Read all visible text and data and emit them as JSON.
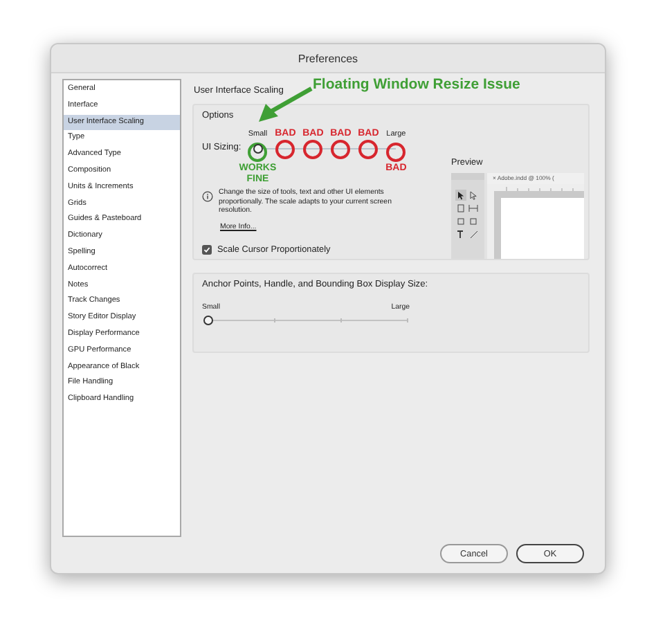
{
  "window": {
    "title": "Preferences"
  },
  "sidebar": {
    "items": [
      {
        "label": "General",
        "selected": false
      },
      {
        "label": "Interface",
        "selected": false
      },
      {
        "label": "User Interface Scaling",
        "selected": true
      },
      {
        "label": "Type",
        "selected": false
      },
      {
        "label": "Advanced Type",
        "selected": false
      },
      {
        "label": "Composition",
        "selected": false
      },
      {
        "label": "Units & Increments",
        "selected": false
      },
      {
        "label": "Grids",
        "selected": false
      },
      {
        "label": "Guides & Pasteboard",
        "selected": false
      },
      {
        "label": "Dictionary",
        "selected": false
      },
      {
        "label": "Spelling",
        "selected": false
      },
      {
        "label": "Autocorrect",
        "selected": false
      },
      {
        "label": "Notes",
        "selected": false
      },
      {
        "label": "Track Changes",
        "selected": false
      },
      {
        "label": "Story Editor Display",
        "selected": false
      },
      {
        "label": "Display Performance",
        "selected": false
      },
      {
        "label": "GPU Performance",
        "selected": false
      },
      {
        "label": "Appearance of Black",
        "selected": false
      },
      {
        "label": "File Handling",
        "selected": false
      },
      {
        "label": "Clipboard Handling",
        "selected": false
      }
    ]
  },
  "section_title": "User Interface Scaling",
  "annotation_title": "Floating Window Resize Issue",
  "options": {
    "title": "Options",
    "ui_sizing": {
      "label": "UI Sizing:",
      "level": 0,
      "stops": [
        {
          "scale_label": "Small",
          "note_below": "WORKS FINE",
          "color": "#3f9f35"
        },
        {
          "note": "BAD",
          "color": "#d7262e"
        },
        {
          "note": "BAD",
          "color": "#d7262e"
        },
        {
          "note": "BAD",
          "color": "#d7262e"
        },
        {
          "note": "BAD",
          "color": "#d7262e"
        },
        {
          "scale_label": "Large",
          "note_below": "BAD",
          "color": "#d7262e"
        }
      ]
    },
    "info": "Change the size of tools, text and other UI elements proportionally. The scale adapts to your current screen resolution.",
    "more_info_link": "More Info...",
    "scale_cursor": {
      "label": "Scale Cursor Proportionately",
      "checked": true
    },
    "preview": {
      "label": "Preview",
      "tab": "× Adobe.indd @ 100% ("
    }
  },
  "anchor_group": {
    "title": "Anchor Points, Handle, and Bounding Box Display Size:",
    "min_label": "Small",
    "max_label": "Large",
    "level": 0
  },
  "buttons": [
    {
      "label": "Cancel",
      "default": false
    },
    {
      "label": "OK",
      "default": true
    }
  ]
}
